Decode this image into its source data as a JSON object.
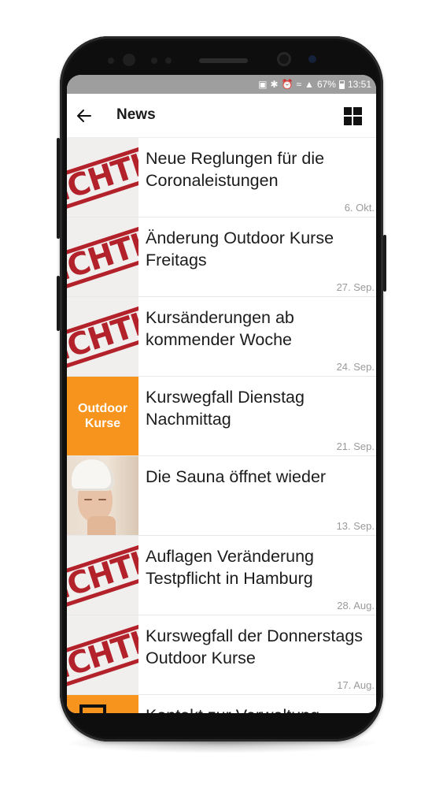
{
  "status_bar": {
    "battery": "67%",
    "time": "13:51"
  },
  "app_bar": {
    "title": "News"
  },
  "news": [
    {
      "title": "Neue Reglungen für die Coronaleistungen",
      "date": "6. Okt.",
      "thumb": "wichtig-stamp"
    },
    {
      "title": "Änderung Outdoor Kurse Freitags",
      "date": "27. Sep.",
      "thumb": "wichtig-stamp"
    },
    {
      "title": "Kursänderungen ab kommender Woche",
      "date": "24. Sep.",
      "thumb": "wichtig-stamp"
    },
    {
      "title": "Kurswegfall Dienstag Nachmittag",
      "date": "21. Sep.",
      "thumb": "outdoor-kurse"
    },
    {
      "title": "Die Sauna öffnet wieder",
      "date": "13. Sep.",
      "thumb": "sauna-photo"
    },
    {
      "title": "Auflagen Veränderung Testpflicht in Hamburg",
      "date": "28. Aug.",
      "thumb": "wichtig-stamp"
    },
    {
      "title": "Kurswegfall der Donnerstags Outdoor Kurse",
      "date": "17. Aug.",
      "thumb": "wichtig-stamp"
    },
    {
      "title": "Kontakt zur Verwaltung",
      "date": "",
      "thumb": "calendar-icon"
    }
  ],
  "thumb_text": {
    "stamp": "ICHTIG",
    "outdoor_line1": "Outdoor",
    "outdoor_line2": "Kurse"
  },
  "colors": {
    "accent_orange": "#f7941d",
    "stamp_red": "#b3222b",
    "status_bar": "#9e9e9e"
  },
  "icons": {
    "back": "arrow-left-icon",
    "layout": "grid-view-icon"
  }
}
